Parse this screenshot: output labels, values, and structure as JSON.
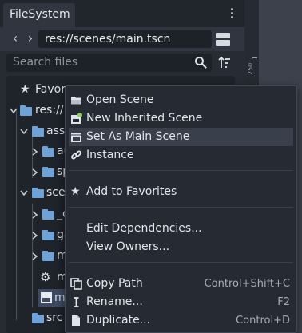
{
  "dock": {
    "tab_label": "FileSystem",
    "path": "res://scenes/main.tscn",
    "search_placeholder": "Search files"
  },
  "tree": [
    {
      "label": "Favor"
    },
    {
      "label": "res://"
    },
    {
      "label": "ass"
    },
    {
      "label": "au"
    },
    {
      "label": "sp"
    },
    {
      "label": "sce"
    },
    {
      "label": "_c"
    },
    {
      "label": "ga"
    },
    {
      "label": "m"
    },
    {
      "label": "m"
    },
    {
      "label": "m"
    },
    {
      "label": "src"
    }
  ],
  "editor": {
    "ruler_value": "250"
  },
  "menu": {
    "items": [
      {
        "label": "Open Scene",
        "icon": "folder-open-icon"
      },
      {
        "label": "New Inherited Scene",
        "icon": "new-inherited-scene-icon"
      },
      {
        "label": "Set As Main Scene",
        "icon": "clapperboard-icon"
      },
      {
        "label": "Instance",
        "icon": "link-icon"
      },
      {
        "label": "Add to Favorites",
        "icon": "star-icon"
      },
      {
        "label": "Edit Dependencies...",
        "icon": ""
      },
      {
        "label": "View Owners...",
        "icon": ""
      },
      {
        "label": "Copy Path",
        "icon": "copy-icon",
        "shortcut": "Control+Shift+C"
      },
      {
        "label": "Rename...",
        "icon": "text-cursor-icon",
        "shortcut": "F2"
      },
      {
        "label": "Duplicate...",
        "icon": "duplicate-icon",
        "shortcut": "Control+D"
      }
    ]
  },
  "colors": {
    "folder": "#6fa3d8",
    "highlight": "#3d4a61",
    "menu_hover": "#3a404b"
  }
}
